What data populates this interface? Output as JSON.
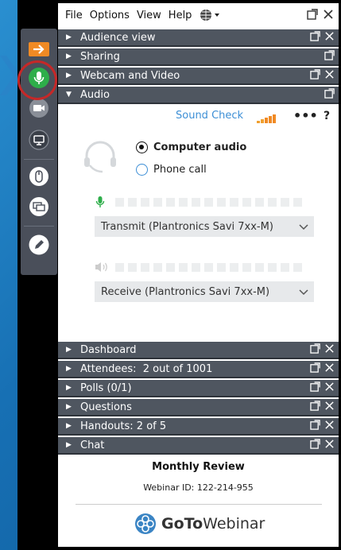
{
  "menubar": {
    "items": [
      "File",
      "Options",
      "View",
      "Help"
    ]
  },
  "sections_top": [
    {
      "label": "Audience view",
      "expanded": false
    },
    {
      "label": "Sharing",
      "expanded": false
    },
    {
      "label": "Webcam and Video",
      "expanded": false
    },
    {
      "label": "Audio",
      "expanded": true
    }
  ],
  "audio": {
    "sound_check": "Sound Check",
    "more": "•••",
    "help": "?",
    "options": [
      {
        "label": "Computer audio",
        "selected": true
      },
      {
        "label": "Phone call",
        "selected": false
      }
    ],
    "transmit_device": "Transmit (Plantronics Savi 7xx-M)",
    "receive_device": "Receive (Plantronics Savi 7xx-M)"
  },
  "sections_bottom": [
    {
      "label": "Dashboard"
    },
    {
      "label": "Attendees:  2 out of 1001"
    },
    {
      "label": "Polls (0/1)"
    },
    {
      "label": "Questions"
    },
    {
      "label": "Handouts: 2 of 5"
    },
    {
      "label": "Chat"
    }
  ],
  "footer": {
    "title": "Monthly Review",
    "webinar_id": "Webinar ID: 122-214-955",
    "brand_bold": "GoTo",
    "brand_light": "Webinar"
  },
  "colors": {
    "header_bg": "#4f5660",
    "accent_blue": "#3d8fd6",
    "mic_green": "#2eae4a",
    "orange": "#f08a24",
    "highlight_red": "#c62828"
  }
}
